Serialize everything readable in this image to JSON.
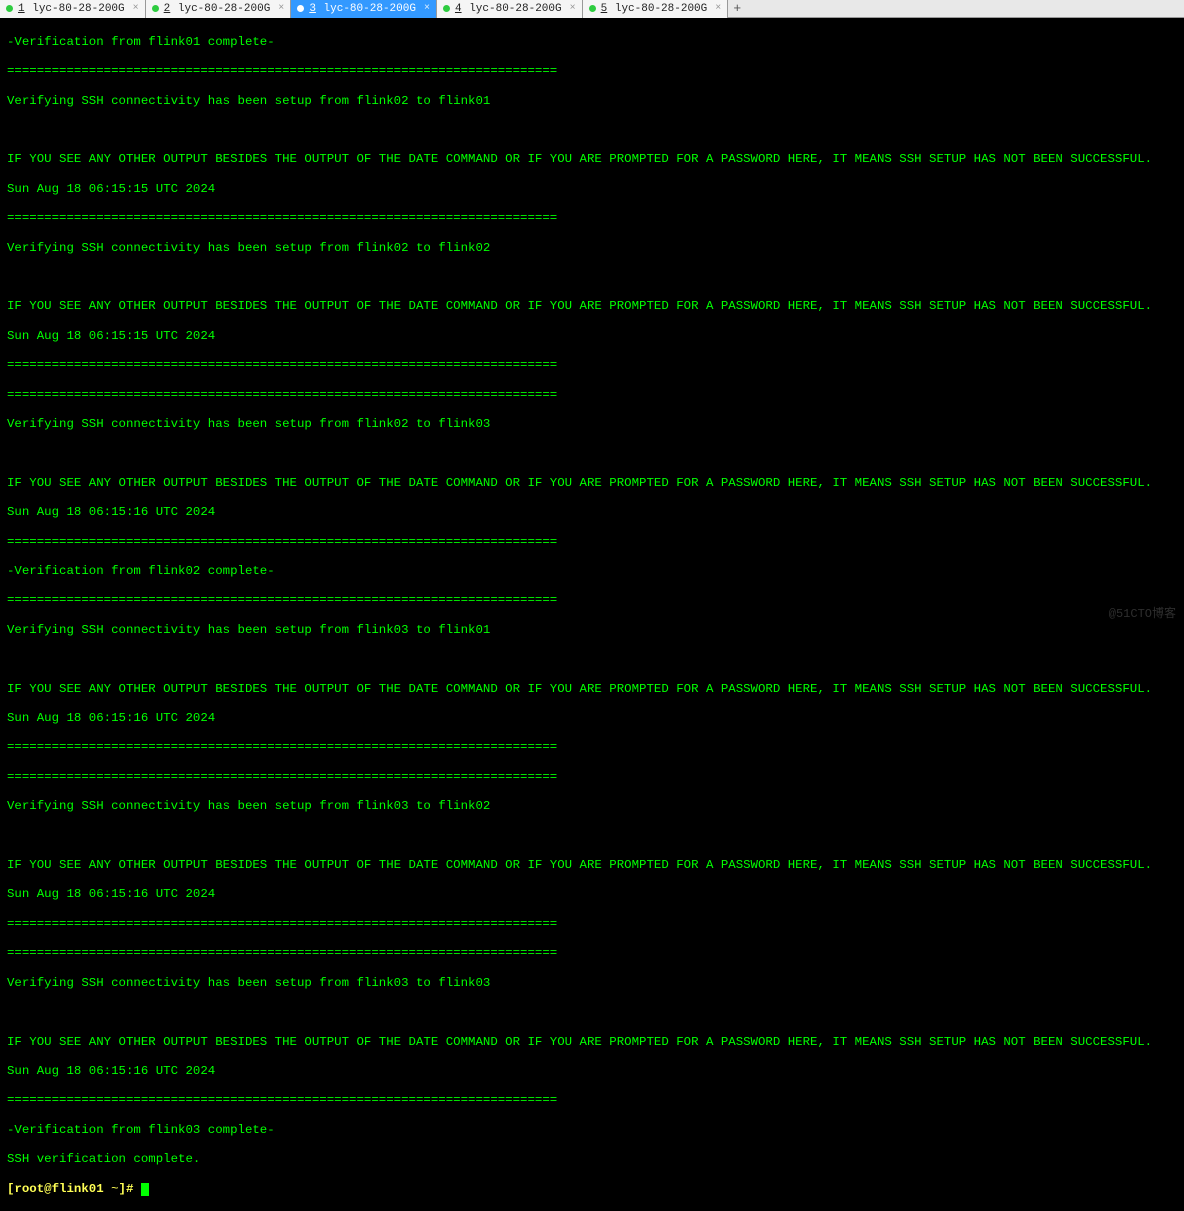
{
  "tabs": [
    {
      "num": "1",
      "label": "lyc-80-28-200G",
      "active": false
    },
    {
      "num": "2",
      "label": "lyc-80-28-200G",
      "active": false
    },
    {
      "num": "3",
      "label": "lyc-80-28-200G",
      "active": true
    },
    {
      "num": "4",
      "label": "lyc-80-28-200G",
      "active": false
    },
    {
      "num": "5",
      "label": "lyc-80-28-200G",
      "active": false
    }
  ],
  "top_right": "",
  "watermark": "@51CTO博客",
  "divider": "==========================================================================",
  "terminal": {
    "verif_from_01": "-Verification from flink01 complete-",
    "verif_setup_02_01": "Verifying SSH connectivity has been setup from flink02 to flink01",
    "warn": "IF YOU SEE ANY OTHER OUTPUT BESIDES THE OUTPUT OF THE DATE COMMAND OR IF YOU ARE PROMPTED FOR A PASSWORD HERE, IT MEANS SSH SETUP HAS NOT BEEN SUCCESSFUL.",
    "ts_15": "Sun Aug 18 06:15:15 UTC 2024",
    "verif_setup_02_02": "Verifying SSH connectivity has been setup from flink02 to flink02",
    "verif_setup_02_03": "Verifying SSH connectivity has been setup from flink02 to flink03",
    "ts_16": "Sun Aug 18 06:15:16 UTC 2024",
    "verif_from_02": "-Verification from flink02 complete-",
    "verif_setup_03_01": "Verifying SSH connectivity has been setup from flink03 to flink01",
    "verif_setup_03_02": "Verifying SSH connectivity has been setup from flink03 to flink02",
    "verif_setup_03_03": "Verifying SSH connectivity has been setup from flink03 to flink03",
    "verif_from_03": "-Verification from flink03 complete-",
    "ssh_complete": "SSH verification complete.",
    "prompt_open": "[",
    "prompt_user": "root@flink01",
    "prompt_path": " ~",
    "prompt_close": "]# "
  }
}
